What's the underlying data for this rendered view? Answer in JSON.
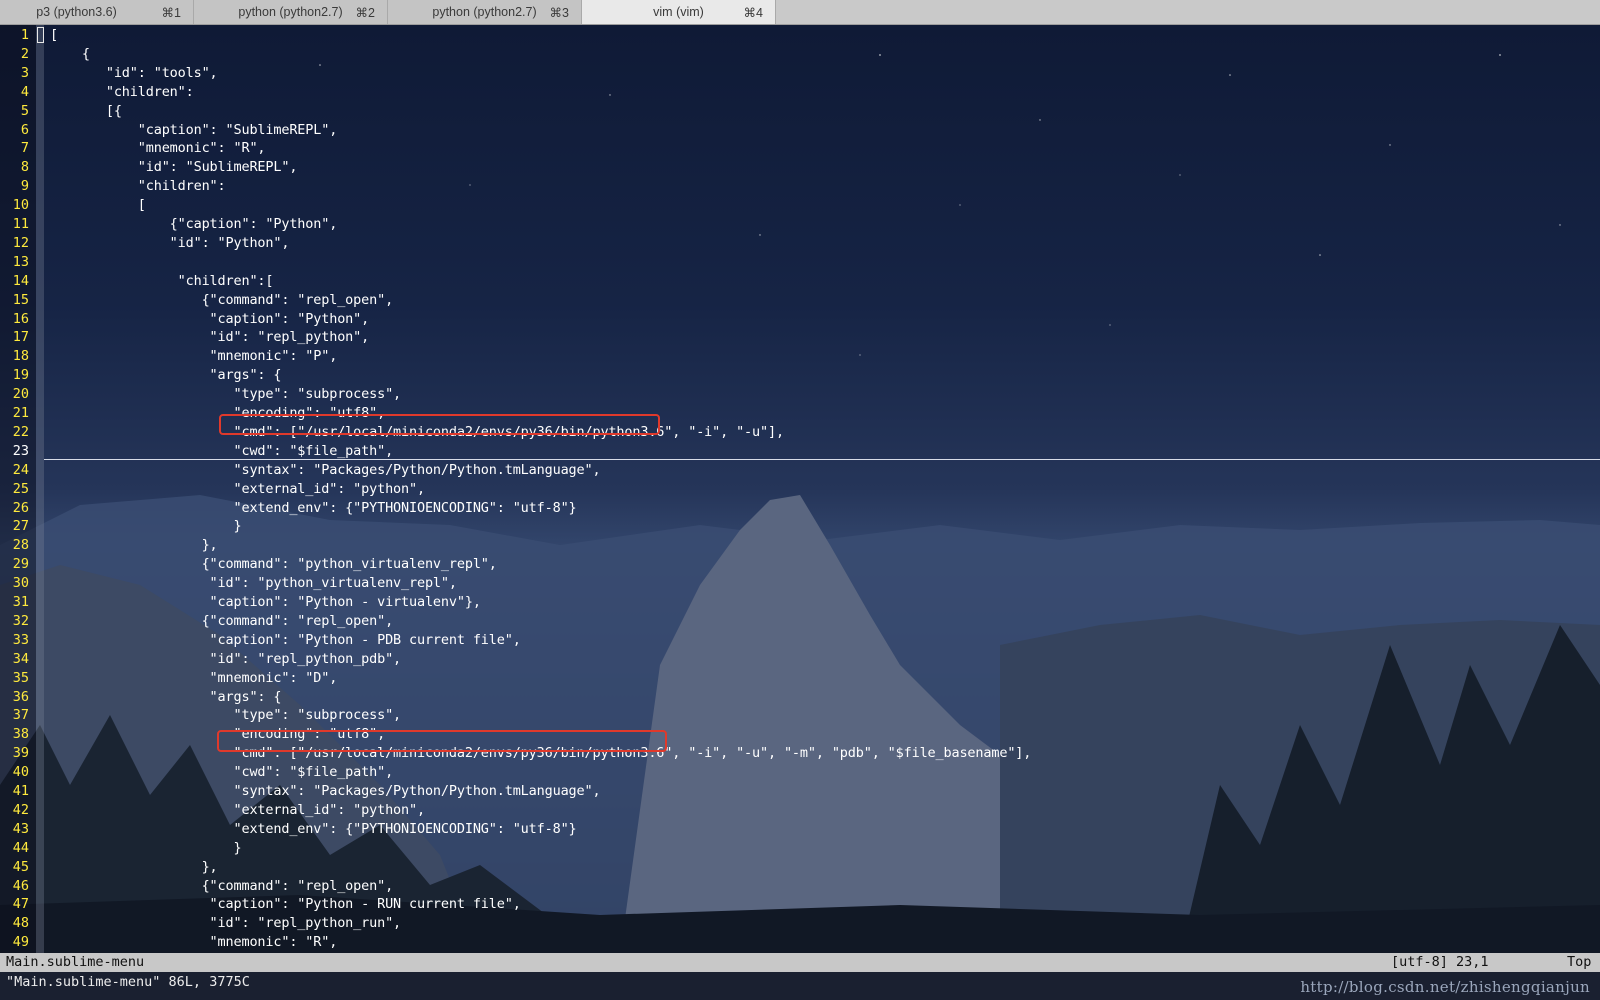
{
  "tabs": [
    {
      "label": "p3 (python3.6)",
      "shortcut": "⌘1",
      "active": false
    },
    {
      "label": "python (python2.7)",
      "shortcut": "⌘2",
      "active": false
    },
    {
      "label": "python (python2.7)",
      "shortcut": "⌘3",
      "active": false
    },
    {
      "label": "vim (vim)",
      "shortcut": "⌘4",
      "active": true
    }
  ],
  "editor": {
    "lines": [
      "[",
      "    {",
      "       \"id\": \"tools\",",
      "       \"children\":",
      "       [{",
      "           \"caption\": \"SublimeREPL\",",
      "           \"mnemonic\": \"R\",",
      "           \"id\": \"SublimeREPL\",",
      "           \"children\":",
      "           [",
      "               {\"caption\": \"Python\",",
      "               \"id\": \"Python\",",
      "",
      "                \"children\":[",
      "                   {\"command\": \"repl_open\",",
      "                    \"caption\": \"Python\",",
      "                    \"id\": \"repl_python\",",
      "                    \"mnemonic\": \"P\",",
      "                    \"args\": {",
      "                       \"type\": \"subprocess\",",
      "                       \"encoding\": \"utf8\",",
      "                       \"cmd\": [\"/usr/local/miniconda2/envs/py36/bin/python3.6\", \"-i\", \"-u\"],",
      "                       \"cwd\": \"$file_path\",",
      "                       \"syntax\": \"Packages/Python/Python.tmLanguage\",",
      "                       \"external_id\": \"python\",",
      "                       \"extend_env\": {\"PYTHONIOENCODING\": \"utf-8\"}",
      "                       }",
      "                   },",
      "                   {\"command\": \"python_virtualenv_repl\",",
      "                    \"id\": \"python_virtualenv_repl\",",
      "                    \"caption\": \"Python - virtualenv\"},",
      "                   {\"command\": \"repl_open\",",
      "                    \"caption\": \"Python - PDB current file\",",
      "                    \"id\": \"repl_python_pdb\",",
      "                    \"mnemonic\": \"D\",",
      "                    \"args\": {",
      "                       \"type\": \"subprocess\",",
      "                       \"encoding\": \"utf8\",",
      "                       \"cmd\": [\"/usr/local/miniconda2/envs/py36/bin/python3.6\", \"-i\", \"-u\", \"-m\", \"pdb\", \"$file_basename\"],",
      "                       \"cwd\": \"$file_path\",",
      "                       \"syntax\": \"Packages/Python/Python.tmLanguage\",",
      "                       \"external_id\": \"python\",",
      "                       \"extend_env\": {\"PYTHONIOENCODING\": \"utf-8\"}",
      "                       }",
      "                   },",
      "                   {\"command\": \"repl_open\",",
      "                    \"caption\": \"Python - RUN current file\",",
      "                    \"id\": \"repl_python_run\",",
      "                    \"mnemonic\": \"R\","
    ],
    "cursor_line": 23,
    "highlighted_lines": [
      22,
      39
    ]
  },
  "statusline": {
    "filename": "Main.sublime-menu",
    "encoding_position": "[utf-8] 23,1",
    "scroll": "Top"
  },
  "cmdline": {
    "message": "\"Main.sublime-menu\" 86L, 3775C"
  },
  "watermark": "http://blog.csdn.net/zhishengqianjun",
  "colors": {
    "line_number": "#ffea3d",
    "highlight_box": "#e0392b",
    "statusline_bg": "#c8c8c8"
  }
}
